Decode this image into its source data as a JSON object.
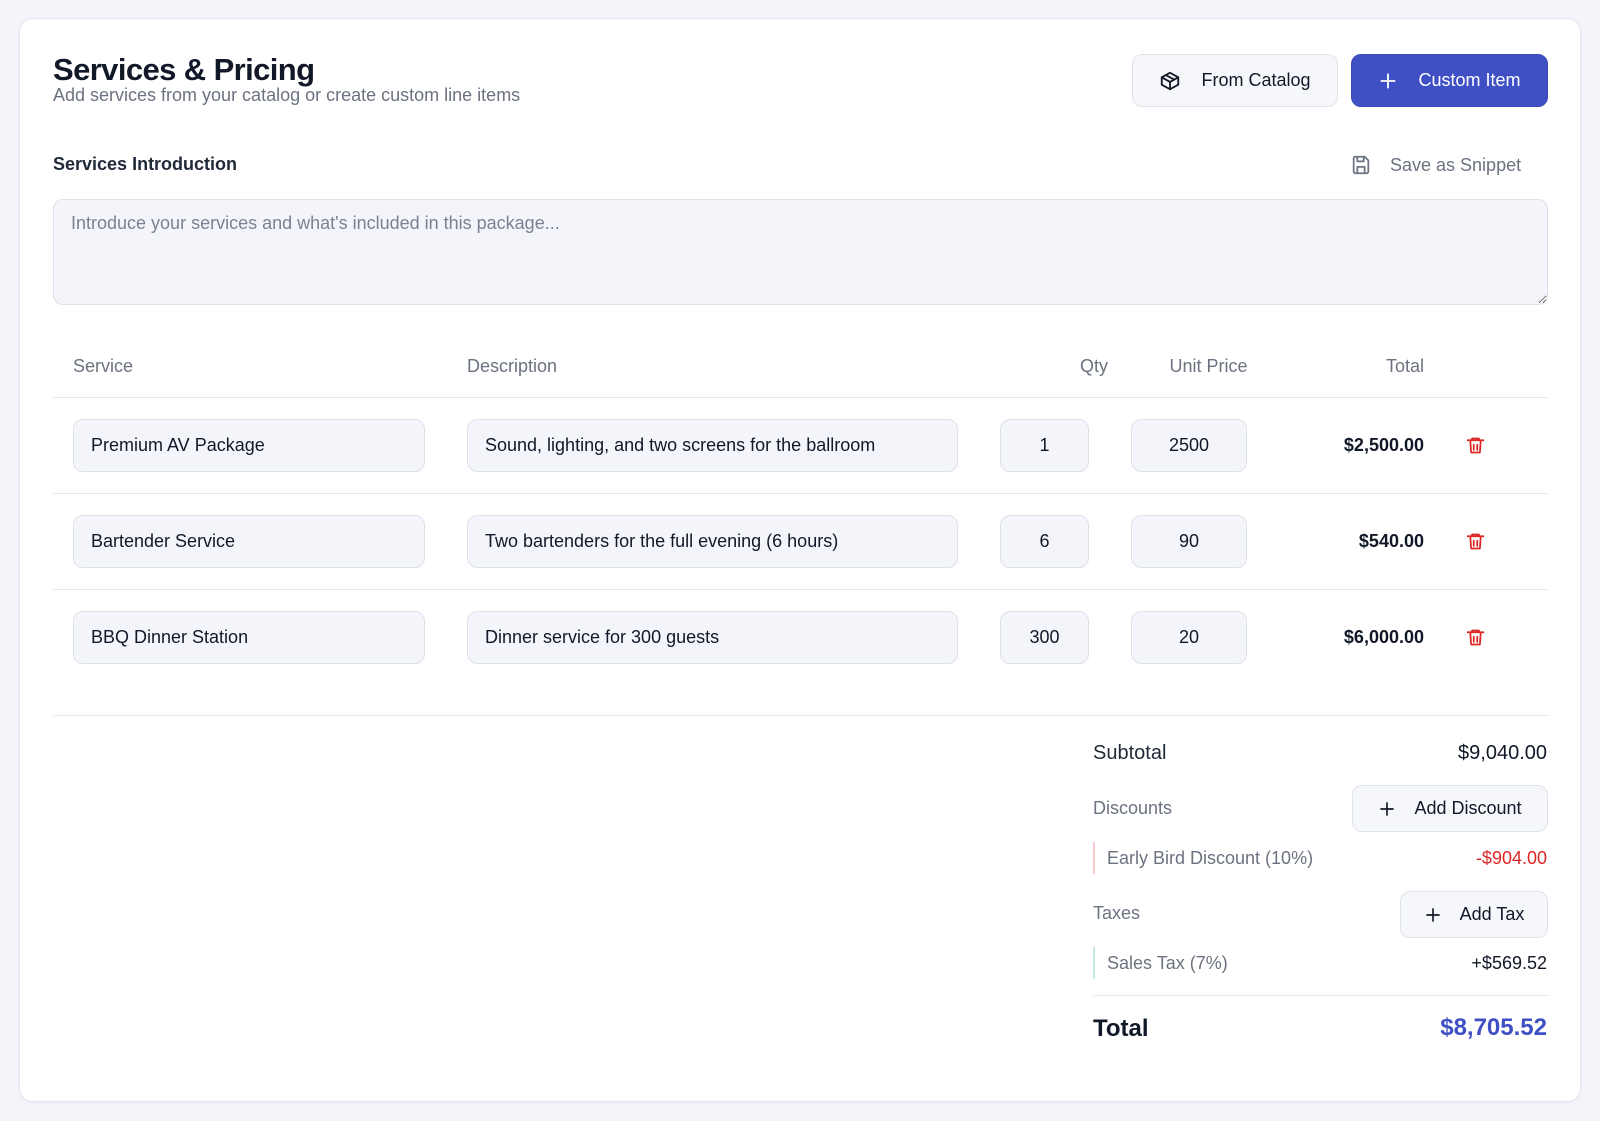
{
  "header": {
    "title": "Services & Pricing",
    "subtitle": "Add services from your catalog or create custom line items",
    "from_catalog_label": "From Catalog",
    "custom_item_label": "Custom Item"
  },
  "intro": {
    "label": "Services Introduction",
    "save_snippet_label": "Save as Snippet",
    "placeholder": "Introduce your services and what's included in this package...",
    "value": ""
  },
  "table": {
    "columns": [
      "Service",
      "Description",
      "Qty",
      "Unit Price",
      "Total"
    ],
    "rows": [
      {
        "service": "Premium AV Package",
        "description": "Sound, lighting, and two screens for the ballroom",
        "qty": "1",
        "unit_price": "2500",
        "total": "$2,500.00"
      },
      {
        "service": "Bartender Service",
        "description": "Two bartenders for the full evening (6 hours)",
        "qty": "6",
        "unit_price": "90",
        "total": "$540.00"
      },
      {
        "service": "BBQ Dinner Station",
        "description": "Dinner service for 300 guests",
        "qty": "300",
        "unit_price": "20",
        "total": "$6,000.00"
      }
    ]
  },
  "summary": {
    "subtotal_label": "Subtotal",
    "subtotal_value": "$9,040.00",
    "discounts_label": "Discounts",
    "add_discount_label": "Add Discount",
    "discount_item_label": "Early Bird Discount (10%)",
    "discount_item_value": "-$904.00",
    "taxes_label": "Taxes",
    "add_tax_label": "Add Tax",
    "tax_item_label": "Sales Tax (7%)",
    "tax_item_value": "+$569.52",
    "total_label": "Total",
    "total_value": "$8,705.52"
  },
  "icons": {
    "catalog": "package-icon",
    "custom": "plus-icon",
    "snippet": "save-icon",
    "delete": "trash-icon"
  },
  "colors": {
    "primary": "#3f4fc4",
    "danger": "#dc2626",
    "discount_accent": "#f8c9cf",
    "tax_accent": "#c7ecd9",
    "background": "#f4f5fa"
  }
}
